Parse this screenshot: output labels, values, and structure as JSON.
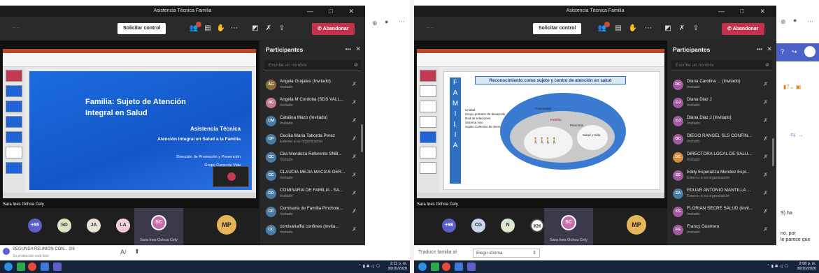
{
  "left": {
    "window_title": "Asistencia Técnica Familia",
    "window_controls": "—  □  ✕",
    "timer": "--:--",
    "request_control": "Solicitar control",
    "leave": "Abandonar",
    "participants": {
      "title": "Participantes",
      "search_placeholder": "Escribe un nombre",
      "items": [
        {
          "initials": "AG",
          "name": "Angela Grajales (Invitado)",
          "sub": "Invitado",
          "color": "#8a6d3b"
        },
        {
          "initials": "AC",
          "name": "Angela M Cordoba (SDS VALL...",
          "sub": "Invitado",
          "color": "#c67a8c"
        },
        {
          "initials": "CM",
          "name": "Catalina Mazo (Invitado)",
          "sub": "Invitado",
          "color": "#4a7aa8"
        },
        {
          "initials": "CP",
          "name": "Cecilia Maria Taborda Perez",
          "sub": "Externo a su organización",
          "color": "#4a7aa8"
        },
        {
          "initials": "CC",
          "name": "Cira Mendoza Referente SNB...",
          "sub": "Invitado",
          "color": "#4a7aa8"
        },
        {
          "initials": "CC",
          "name": "CLAUDIA MEJIA MACIAS GER...",
          "sub": "Invitado",
          "color": "#4a7aa8"
        },
        {
          "initials": "CO",
          "name": "COMISARIA DE FAMILIA - SA...",
          "sub": "Invitado",
          "color": "#4a7aa8"
        },
        {
          "initials": "CP",
          "name": "Comisaria de Familia Pinchote...",
          "sub": "Invitado",
          "color": "#4a7aa8"
        },
        {
          "initials": "CC",
          "name": "comisariaffia confines (Invita...",
          "sub": "Invitado",
          "color": "#4a7aa8"
        }
      ]
    },
    "slide": {
      "title_line1": "Familia: Sujeto de Atención",
      "title_line2": "Integral en Salud",
      "sub1": "Asistencia Técnica",
      "sub2": "Atención Integral en Salud a la Familia",
      "sub3": "Dirección de Promoción y Prevención",
      "sub4": "Grupo Curso de Vida"
    },
    "presenter": "Sara Ines Ochoa Cely",
    "avatars": [
      {
        "label": "+55",
        "bg": "#5b5fc7",
        "fg": "#ffffff"
      },
      {
        "label": "SD",
        "bg": "#d9e6c6",
        "fg": "#333333"
      },
      {
        "label": "JA",
        "bg": "#e9e2d5",
        "fg": "#333333"
      },
      {
        "label": "LA",
        "bg": "#f0cfd6",
        "fg": "#333333"
      }
    ],
    "main_avatar": "SC",
    "main_avatar_label": "Sara Ines Ochoa Cely",
    "big_avatar": "MP",
    "chat_title": "SEGUNDA REUNIÓN CON...  2/8",
    "chat_note": "Su protección está listo",
    "clock_time": "2:11 p. m.",
    "clock_date": "30/10/2020"
  },
  "right": {
    "window_title": "Asistencia Técnica Familia",
    "window_controls": "—  □  ✕",
    "timer": "--:--",
    "request_control": "Solicitar control",
    "leave": "Abandonar",
    "participants": {
      "title": "Participantes",
      "search_placeholder": "Escribe un nombre",
      "items": [
        {
          "initials": "DC",
          "name": "Diana Carolina ... (Invitado)",
          "sub": "Invitado",
          "color": "#a45aa0"
        },
        {
          "initials": "DJ",
          "name": "Diana Diaz J",
          "sub": "Invitado",
          "color": "#a45aa0"
        },
        {
          "initials": "DJ",
          "name": "Diana Diaz J (Invitado)",
          "sub": "Invitado",
          "color": "#a45aa0"
        },
        {
          "initials": "DC",
          "name": "DIEGO RANGEL SLS CONFINE...",
          "sub": "Invitado",
          "color": "#a45aa0"
        },
        {
          "initials": "DC",
          "name": "DIRECTORA LOCAL DE SALUD...",
          "sub": "Invitado",
          "color": "#d98a3a"
        },
        {
          "initials": "EE",
          "name": "Eddy Esperanza Mendez Espi...",
          "sub": "Externo a su organización",
          "color": "#a45aa0"
        },
        {
          "initials": "EA",
          "name": "EDUAR ANTONIO MANTILLA ...",
          "sub": "Externo a su organización",
          "color": "#4a7aa8"
        },
        {
          "initials": "FS",
          "name": "FLORIAN SECRE SALUD (Invit...",
          "sub": "Invitado",
          "color": "#a45aa0"
        },
        {
          "initials": "FG",
          "name": "Francy Guerrero",
          "sub": "Invitado",
          "color": "#a45aa0"
        }
      ]
    },
    "slide": {
      "title": "Reconocimiento como sujeto y centro de atención en salud",
      "side_letters": [
        "F",
        "A",
        "M",
        "I",
        "L",
        "I",
        "A"
      ],
      "bullets": [
        "Unidad",
        "Grupo primario de desarrollo",
        "Red de relaciones",
        "Sistema vivo",
        "Sujeto Colectivo de derechos"
      ],
      "ellipse_label1": "Comunidad",
      "ellipse_label2": "Familia",
      "ellipse_label3": "Personas",
      "ellipse_label4": "Salud y Vida"
    },
    "presenter": "Sara Ines Ochoa Cely",
    "avatars": [
      {
        "label": "+98",
        "bg": "#5b5fc7",
        "fg": "#ffffff"
      },
      {
        "label": "CG",
        "bg": "#c9d6ec",
        "fg": "#333333"
      },
      {
        "label": "N",
        "bg": "#dbe8cf",
        "fg": "#333333"
      },
      {
        "label": "KH",
        "bg": "#ffffff",
        "fg": "#333333"
      }
    ],
    "main_avatar": "SC",
    "main_avatar_label": "Sara Ines Ochoa Cely",
    "big_avatar": "MP",
    "translate_label": "Traducir familia al",
    "translate_select": "Elegir idioma",
    "edge_text1": "S) ha",
    "edge_text2": "no, por",
    "edge_text3": "le parece que",
    "clock_time": "2:08 p. m.",
    "clock_date": "30/10/2020"
  }
}
